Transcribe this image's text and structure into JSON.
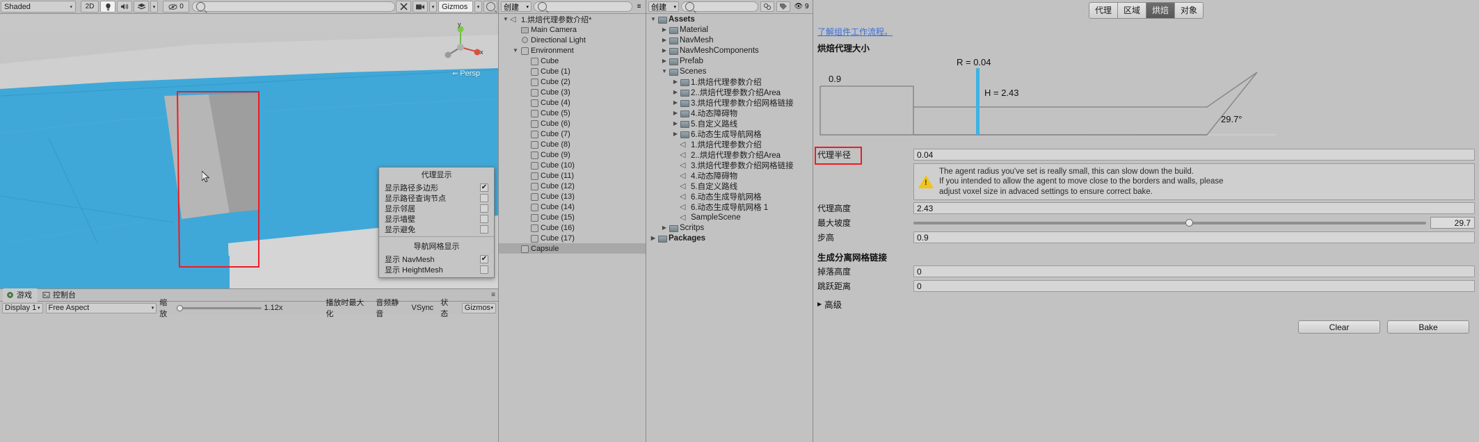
{
  "scene_toolbar": {
    "shading_mode": "Shaded",
    "mode_2d": "2D",
    "lighting_icon": "lightbulb-icon",
    "audio_icon": "speaker-icon",
    "fx_icon": "effects-icon",
    "visibility_icon": "eye-icon",
    "hidden_count": "0",
    "tools_icon": "tools-icon",
    "camera_icon": "camera-icon",
    "gizmos_label": "Gizmos",
    "search_icon": "search-icon"
  },
  "scene_view": {
    "persp_label": "Persp",
    "gizmo_axis_y": "y",
    "gizmo_axis_x": "x",
    "cursor": "pointer-cursor"
  },
  "agent_display_popup": {
    "title": "代理显示",
    "items": [
      {
        "label": "显示路径多边形",
        "checked": true
      },
      {
        "label": "显示路径查询节点",
        "checked": false
      },
      {
        "label": "显示邻居",
        "checked": false
      },
      {
        "label": "显示墙壁",
        "checked": false
      },
      {
        "label": "显示避免",
        "checked": false
      }
    ],
    "section2_title": "导航网格显示",
    "section2_items": [
      {
        "label": "显示 NavMesh",
        "checked": true
      },
      {
        "label": "显示 HeightMesh",
        "checked": false
      }
    ]
  },
  "game_tabs": {
    "tabs": [
      {
        "label": "游戏",
        "icon": "game-icon",
        "selected": true
      },
      {
        "label": "控制台",
        "icon": "console-icon",
        "selected": false
      }
    ],
    "display": "Display 1",
    "aspect": "Free Aspect",
    "scale_label": "缩放",
    "scale_value": "1.12x",
    "maximize_on_play": "播放时最大化",
    "mute_audio": "音频静音",
    "vsync": "VSync",
    "stats": "状态",
    "gizmos": "Gizmos"
  },
  "hierarchy": {
    "create_label": "创建",
    "search_placeholder": "",
    "rows": [
      {
        "indent": 0,
        "tri": "▼",
        "icon": "unity-icon",
        "label": "1.烘焙代理参数介绍*",
        "selected": false
      },
      {
        "indent": 1,
        "tri": "",
        "icon": "camera-icon",
        "label": "Main Camera",
        "selected": false
      },
      {
        "indent": 1,
        "tri": "",
        "icon": "light-icon",
        "label": "Directional Light",
        "selected": false
      },
      {
        "indent": 1,
        "tri": "▼",
        "icon": "cube-icon",
        "label": "Environment",
        "selected": false
      },
      {
        "indent": 2,
        "tri": "",
        "icon": "cube-icon",
        "label": "Cube",
        "selected": false
      },
      {
        "indent": 2,
        "tri": "",
        "icon": "cube-icon",
        "label": "Cube (1)",
        "selected": false
      },
      {
        "indent": 2,
        "tri": "",
        "icon": "cube-icon",
        "label": "Cube (2)",
        "selected": false
      },
      {
        "indent": 2,
        "tri": "",
        "icon": "cube-icon",
        "label": "Cube (3)",
        "selected": false
      },
      {
        "indent": 2,
        "tri": "",
        "icon": "cube-icon",
        "label": "Cube (4)",
        "selected": false
      },
      {
        "indent": 2,
        "tri": "",
        "icon": "cube-icon",
        "label": "Cube (5)",
        "selected": false
      },
      {
        "indent": 2,
        "tri": "",
        "icon": "cube-icon",
        "label": "Cube (6)",
        "selected": false
      },
      {
        "indent": 2,
        "tri": "",
        "icon": "cube-icon",
        "label": "Cube (7)",
        "selected": false
      },
      {
        "indent": 2,
        "tri": "",
        "icon": "cube-icon",
        "label": "Cube (8)",
        "selected": false
      },
      {
        "indent": 2,
        "tri": "",
        "icon": "cube-icon",
        "label": "Cube (9)",
        "selected": false
      },
      {
        "indent": 2,
        "tri": "",
        "icon": "cube-icon",
        "label": "Cube (10)",
        "selected": false
      },
      {
        "indent": 2,
        "tri": "",
        "icon": "cube-icon",
        "label": "Cube (11)",
        "selected": false
      },
      {
        "indent": 2,
        "tri": "",
        "icon": "cube-icon",
        "label": "Cube (12)",
        "selected": false
      },
      {
        "indent": 2,
        "tri": "",
        "icon": "cube-icon",
        "label": "Cube (13)",
        "selected": false
      },
      {
        "indent": 2,
        "tri": "",
        "icon": "cube-icon",
        "label": "Cube (14)",
        "selected": false
      },
      {
        "indent": 2,
        "tri": "",
        "icon": "cube-icon",
        "label": "Cube (15)",
        "selected": false
      },
      {
        "indent": 2,
        "tri": "",
        "icon": "cube-icon",
        "label": "Cube (16)",
        "selected": false
      },
      {
        "indent": 2,
        "tri": "",
        "icon": "cube-icon",
        "label": "Cube (17)",
        "selected": false
      },
      {
        "indent": 1,
        "tri": "",
        "icon": "cube-icon",
        "label": "Capsule",
        "selected": true
      }
    ]
  },
  "project": {
    "create_label": "创建",
    "search_placeholder": "",
    "rows": [
      {
        "indent": 0,
        "tri": "▼",
        "icon": "folder-icon",
        "label": "Assets",
        "bold": true
      },
      {
        "indent": 1,
        "tri": "▶",
        "icon": "folder-icon",
        "label": "Material",
        "bold": false
      },
      {
        "indent": 1,
        "tri": "▶",
        "icon": "folder-icon",
        "label": "NavMesh",
        "bold": false
      },
      {
        "indent": 1,
        "tri": "▶",
        "icon": "folder-icon",
        "label": "NavMeshComponents",
        "bold": false
      },
      {
        "indent": 1,
        "tri": "▶",
        "icon": "folder-icon",
        "label": "Prefab",
        "bold": false
      },
      {
        "indent": 1,
        "tri": "▼",
        "icon": "folder-icon",
        "label": "Scenes",
        "bold": false
      },
      {
        "indent": 2,
        "tri": "▶",
        "icon": "folder-icon",
        "label": "1.烘焙代理参数介绍",
        "bold": false
      },
      {
        "indent": 2,
        "tri": "▶",
        "icon": "folder-icon",
        "label": "2..烘焙代理参数介绍Area",
        "bold": false
      },
      {
        "indent": 2,
        "tri": "▶",
        "icon": "folder-icon",
        "label": "3.烘焙代理参数介绍网格链接",
        "bold": false
      },
      {
        "indent": 2,
        "tri": "▶",
        "icon": "folder-icon",
        "label": "4.动态障碍物",
        "bold": false
      },
      {
        "indent": 2,
        "tri": "▶",
        "icon": "folder-icon",
        "label": "5.自定义路线",
        "bold": false
      },
      {
        "indent": 2,
        "tri": "▶",
        "icon": "folder-icon",
        "label": "6.动态生成导航网格",
        "bold": false
      },
      {
        "indent": 2,
        "tri": "",
        "icon": "unity-icon",
        "label": "1.烘焙代理参数介绍",
        "bold": false
      },
      {
        "indent": 2,
        "tri": "",
        "icon": "unity-icon",
        "label": "2..烘焙代理参数介绍Area",
        "bold": false
      },
      {
        "indent": 2,
        "tri": "",
        "icon": "unity-icon",
        "label": "3.烘焙代理参数介绍网格链接",
        "bold": false
      },
      {
        "indent": 2,
        "tri": "",
        "icon": "unity-icon",
        "label": "4.动态障碍物",
        "bold": false
      },
      {
        "indent": 2,
        "tri": "",
        "icon": "unity-icon",
        "label": "5.自定义路线",
        "bold": false
      },
      {
        "indent": 2,
        "tri": "",
        "icon": "unity-icon",
        "label": "6.动态生成导航网格",
        "bold": false
      },
      {
        "indent": 2,
        "tri": "",
        "icon": "unity-icon",
        "label": "6.动态生成导航网格 1",
        "bold": false
      },
      {
        "indent": 2,
        "tri": "",
        "icon": "unity-icon",
        "label": "SampleScene",
        "bold": false
      },
      {
        "indent": 1,
        "tri": "▶",
        "icon": "folder-icon",
        "label": "Scritps",
        "bold": false
      },
      {
        "indent": 0,
        "tri": "▶",
        "icon": "folder-icon",
        "label": "Packages",
        "bold": true
      }
    ]
  },
  "inspector": {
    "tabs": [
      {
        "label": "代理",
        "selected": false
      },
      {
        "label": "区域",
        "selected": false
      },
      {
        "label": "烘焙",
        "selected": true
      },
      {
        "label": "对象",
        "selected": false
      }
    ],
    "help_link": "了解组件工作流程。",
    "section_title": "烘焙代理大小",
    "diagram": {
      "radius_label": "R = 0.04",
      "height_label": "H = 2.43",
      "step_label": "0.9",
      "slope_label": "29.7°"
    },
    "fields": [
      {
        "name": "agent-radius",
        "label": "代理半径",
        "value": "0.04",
        "type": "text",
        "highlighted": true
      },
      {
        "name": "agent-height",
        "label": "代理高度",
        "value": "2.43",
        "type": "text",
        "highlighted": false
      },
      {
        "name": "max-slope",
        "label": "最大坡度",
        "value": "29.7",
        "type": "slider",
        "highlighted": false
      },
      {
        "name": "step-height",
        "label": "步高",
        "value": "0.9",
        "type": "text",
        "highlighted": false
      }
    ],
    "warning": {
      "icon": "warning-icon",
      "lines": [
        "The agent radius you've set is really small, this can slow down the build.",
        "If you intended to allow the agent to move close to the borders and walls, please",
        "adjust voxel size in advaced settings to ensure correct bake."
      ]
    },
    "offmesh_group_title": "生成分离网格链接",
    "offmesh_fields": [
      {
        "name": "drop-height",
        "label": "掉落高度",
        "value": "0"
      },
      {
        "name": "jump-distance",
        "label": "跳跃距离",
        "value": "0"
      }
    ],
    "advanced_label": "高级",
    "advanced_tri": "▶",
    "buttons": {
      "clear": "Clear",
      "bake": "Bake"
    }
  }
}
